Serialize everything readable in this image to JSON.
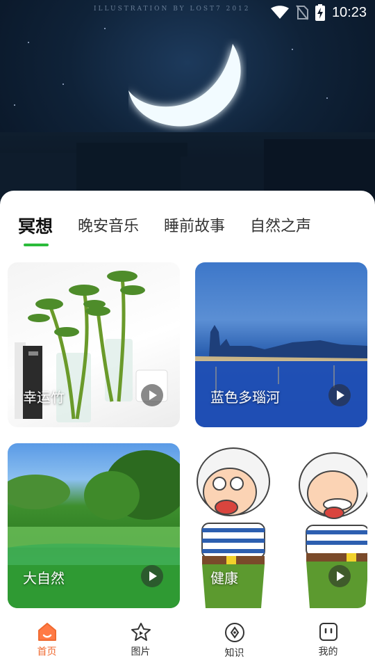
{
  "status_bar": {
    "time": "10:23"
  },
  "hero": {
    "watermark": "ILLUSTRATION BY LOST7 2012"
  },
  "tabs": [
    {
      "label": "冥想",
      "active": true
    },
    {
      "label": "晚安音乐",
      "active": false
    },
    {
      "label": "睡前故事",
      "active": false
    },
    {
      "label": "自然之声",
      "active": false
    }
  ],
  "cards": [
    {
      "title": "幸运竹"
    },
    {
      "title": "蓝色多瑙河"
    },
    {
      "title": "大自然"
    },
    {
      "title": "健康"
    }
  ],
  "bottom_nav": [
    {
      "label": "首页",
      "icon": "home-icon",
      "active": true
    },
    {
      "label": "图片",
      "icon": "star-icon",
      "active": false
    },
    {
      "label": "知识",
      "icon": "compass-icon",
      "active": false
    },
    {
      "label": "我的",
      "icon": "profile-icon",
      "active": false
    }
  ],
  "colors": {
    "accent_green": "#2bbb3a",
    "nav_active": "#f06a30"
  }
}
